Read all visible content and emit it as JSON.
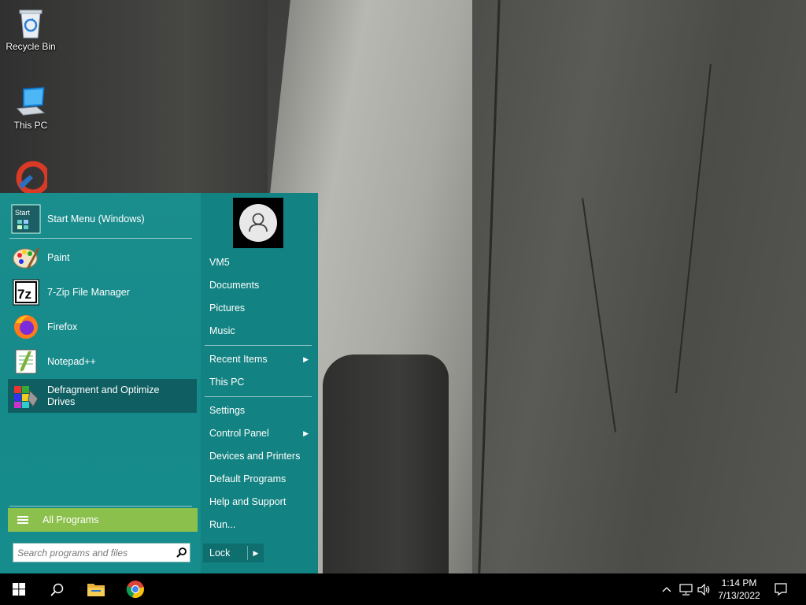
{
  "desktop": {
    "icons": [
      {
        "label": "Recycle Bin",
        "icon": "recycle-bin-icon"
      },
      {
        "label": "This PC",
        "icon": "computer-icon"
      },
      {
        "label": "",
        "icon": "ccleaner-icon"
      }
    ]
  },
  "start_menu": {
    "pinned": [
      {
        "label": "Start Menu (Windows)",
        "icon": "start-menu-app-icon",
        "icon_text": "Start"
      }
    ],
    "recent": [
      {
        "label": "Paint",
        "icon": "paint-icon"
      },
      {
        "label": "7-Zip File Manager",
        "icon": "7zip-icon",
        "icon_text": "7z"
      },
      {
        "label": "Firefox",
        "icon": "firefox-icon"
      },
      {
        "label": "Notepad++",
        "icon": "notepad-plus-plus-icon"
      },
      {
        "label": "Defragment and Optimize Drives",
        "icon": "defrag-icon"
      }
    ],
    "all_programs_label": "All Programs",
    "search_placeholder": "Search programs and files",
    "right_items": {
      "user": "VM5",
      "documents": "Documents",
      "pictures": "Pictures",
      "music": "Music",
      "recent_items": "Recent Items",
      "this_pc": "This PC",
      "settings": "Settings",
      "control_panel": "Control Panel",
      "devices_printers": "Devices and Printers",
      "default_programs": "Default Programs",
      "help_support": "Help and Support",
      "run": "Run..."
    },
    "lock_label": "Lock",
    "submenu_arrow": "▶"
  },
  "taskbar": {
    "time": "1:14 PM",
    "date": "7/13/2022"
  },
  "colors": {
    "menu_bg": "#178c8c",
    "all_programs": "#8cc04c",
    "selected": "#0f5f62"
  }
}
